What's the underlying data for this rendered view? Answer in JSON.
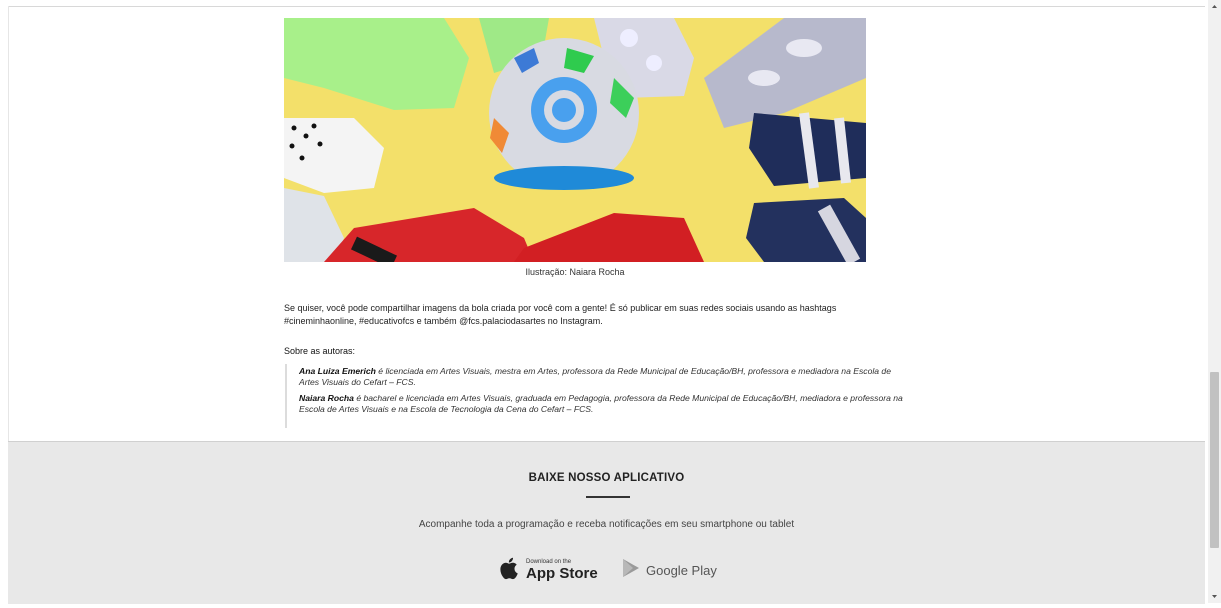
{
  "article": {
    "image_alt": "Bola feita de meias sobre fundo amarelo",
    "caption": "Ilustração: Naiara Rocha",
    "paragraph": "Se quiser, você pode compartilhar imagens da bola criada por você com a gente! É só publicar em suas redes sociais usando as hashtags #cineminhaonline, #educativofcs e também @fcs.palaciodasartes no Instagram.",
    "authors_heading": "Sobre as autoras:",
    "authors": [
      {
        "name": "Ana Luiza Emerich",
        "bio": " é licenciada em Artes Visuais, mestra em Artes, professora da Rede Municipal de Educação/BH, professora e mediadora na Escola de Artes Visuais do Cefart – FCS."
      },
      {
        "name": "Naiara Rocha",
        "bio": " é bacharel e licenciada em Artes Visuais, graduada em Pedagogia, professora da Rede Municipal de Educação/BH, mediadora e professora na Escola de Artes Visuais e na Escola de Tecnologia da Cena do Cefart – FCS."
      }
    ]
  },
  "footer": {
    "title": "BAIXE NOSSO APLICATIVO",
    "subtitle": "Acompanhe toda a programação e receba notificações em seu smartphone ou tablet",
    "app_store": {
      "small": "Download on the",
      "big": "App Store",
      "icon": "apple-icon"
    },
    "google_play": {
      "label": "Google Play",
      "icon": "google-play-icon"
    }
  },
  "scrollbar": {
    "position_fraction": 0.62
  },
  "colors": {
    "footer_bg": "#e8e8e8",
    "photo_bg": "#f2df63"
  }
}
